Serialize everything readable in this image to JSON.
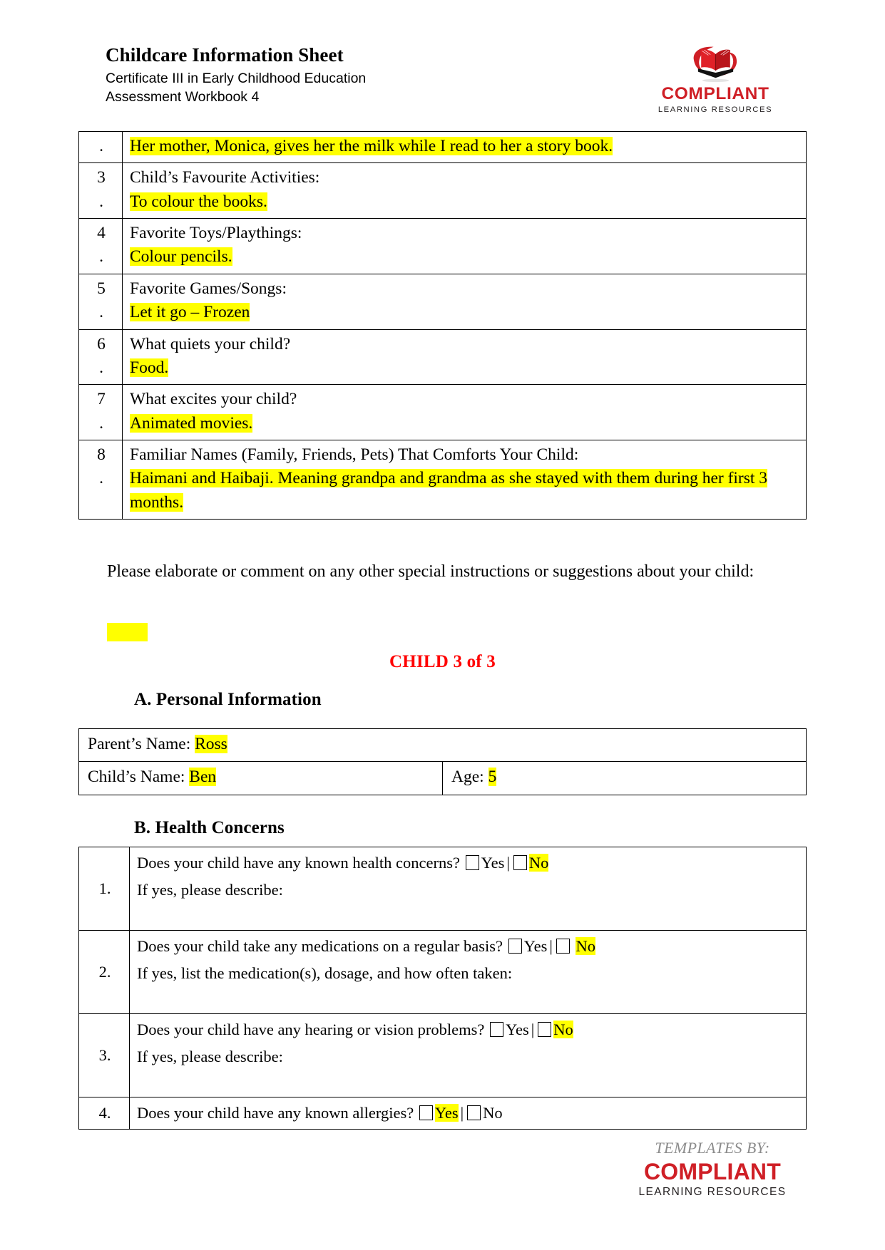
{
  "header": {
    "title": "Childcare Information Sheet",
    "subtitle_line1": "Certificate III in Early Childhood Education",
    "subtitle_line2": "Assessment Workbook 4",
    "logo": {
      "name": "COMPLIANT",
      "tagline": "LEARNING RESOURCES",
      "icon": "open-book-logo-icon",
      "red": "#cf1f26",
      "dark_red": "#a31419"
    }
  },
  "activities_table": {
    "rows": [
      {
        "num_lines": [
          "."
        ],
        "prompt": "",
        "answer": "Her mother, Monica, gives her the milk while I read to her a story book.",
        "answer_highlighted": true
      },
      {
        "num_lines": [
          "3",
          "."
        ],
        "prompt": "Child’s Favourite Activities:",
        "answer": "To colour the books.",
        "answer_highlighted": true
      },
      {
        "num_lines": [
          "4",
          "."
        ],
        "prompt": "Favorite Toys/Playthings:",
        "answer": "Colour pencils.",
        "answer_highlighted": true
      },
      {
        "num_lines": [
          "5",
          "."
        ],
        "prompt": "Favorite Games/Songs:",
        "answer": "Let it go – Frozen",
        "answer_highlighted": true
      },
      {
        "num_lines": [
          "6",
          "."
        ],
        "prompt": "What quiets your child?",
        "answer": "Food.",
        "answer_highlighted": true
      },
      {
        "num_lines": [
          "7",
          "."
        ],
        "prompt": "What excites your child?",
        "answer": "Animated movies.",
        "answer_highlighted": true
      },
      {
        "num_lines": [
          "8",
          "."
        ],
        "prompt": "Familiar Names (Family, Friends, Pets) That Comforts Your Child:",
        "answer": "Haimani and Haibaji. Meaning grandpa and grandma as she stayed with them during her first 3 months.",
        "answer_highlighted": true
      }
    ]
  },
  "elaborate_paragraph": "Please elaborate or comment on any other special instructions or suggestions about your child:",
  "elaborate_answer": "",
  "child_heading": "CHILD 3 of 3",
  "section_a": {
    "heading": "A. Personal Information",
    "parent_label": "Parent’s Name:",
    "parent_value": "Ross",
    "child_label": "Child’s Name:",
    "child_value": "Ben",
    "age_label": "Age:",
    "age_value": "5"
  },
  "section_b": {
    "heading": "B. Health Concerns",
    "yes_label": "Yes",
    "no_label": "No",
    "separator": "|",
    "rows": [
      {
        "number": "1.",
        "question": "Does your child have any known health concerns?",
        "followup": "If yes, please describe:",
        "yes_checked": false,
        "no_checked": false,
        "yes_highlighted": false,
        "no_highlighted": true
      },
      {
        "number": "2.",
        "question": "Does your child take any medications on a regular basis?",
        "followup": "If yes, list the medication(s), dosage, and how often taken:",
        "yes_checked": false,
        "no_checked": false,
        "yes_highlighted": false,
        "no_highlighted": true
      },
      {
        "number": "3.",
        "question": "Does your child have any hearing or vision problems?",
        "followup": "If yes, please describe:",
        "yes_checked": false,
        "no_checked": false,
        "yes_highlighted": false,
        "no_highlighted": true
      },
      {
        "number": "4.",
        "question": "Does your child have any known allergies?",
        "followup": "",
        "yes_checked": false,
        "no_checked": false,
        "yes_highlighted": true,
        "no_highlighted": false
      }
    ]
  },
  "footer": {
    "templates_by": "TEMPLATES BY:",
    "name": "COMPLIANT",
    "tagline": "LEARNING RESOURCES"
  },
  "colors": {
    "highlight": "#ffff00",
    "accent_red": "#ff0000",
    "brand_red": "#cf1f26",
    "footer_gray": "#8c8c8c"
  }
}
